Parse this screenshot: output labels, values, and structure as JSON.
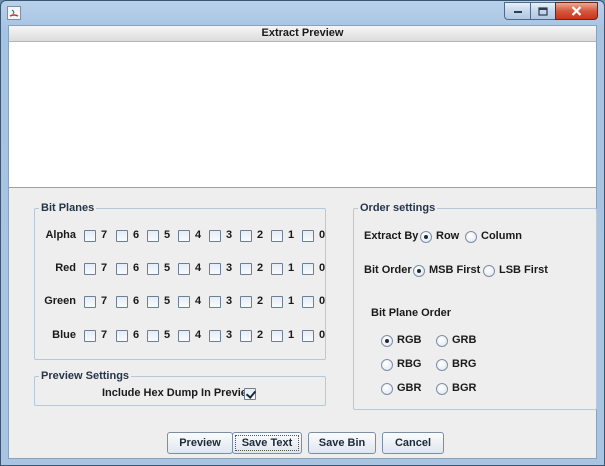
{
  "window": {
    "title": "",
    "icon": "java-app-icon",
    "controls": [
      "minimize-icon",
      "maximize-icon",
      "close-icon"
    ]
  },
  "preview": {
    "header": "Extract Preview",
    "content": ""
  },
  "bit_planes": {
    "legend": "Bit Planes",
    "bits": [
      "7",
      "6",
      "5",
      "4",
      "3",
      "2",
      "1",
      "0"
    ],
    "rows": [
      {
        "label": "Alpha",
        "checked": [
          false,
          false,
          false,
          false,
          false,
          false,
          false,
          false
        ]
      },
      {
        "label": "Red",
        "checked": [
          false,
          false,
          false,
          false,
          false,
          false,
          false,
          false
        ]
      },
      {
        "label": "Green",
        "checked": [
          false,
          false,
          false,
          false,
          false,
          false,
          false,
          false
        ]
      },
      {
        "label": "Blue",
        "checked": [
          false,
          false,
          false,
          false,
          false,
          false,
          false,
          false
        ]
      }
    ]
  },
  "preview_settings": {
    "legend": "Preview Settings",
    "hex_dump_label": "Include Hex Dump In Preview",
    "hex_dump_checked": true
  },
  "order_settings": {
    "legend": "Order settings",
    "extract_by": {
      "label": "Extract By",
      "options": [
        "Row",
        "Column"
      ],
      "selected": "Row"
    },
    "bit_order": {
      "label": "Bit Order",
      "options": [
        "MSB First",
        "LSB First"
      ],
      "selected": "MSB First"
    },
    "bit_plane_order": {
      "label": "Bit Plane Order",
      "options": [
        "RGB",
        "GRB",
        "RBG",
        "BRG",
        "GBR",
        "BGR"
      ],
      "selected": "RGB"
    }
  },
  "buttons": {
    "preview": "Preview",
    "save_text": "Save Text",
    "save_bin": "Save Bin",
    "cancel": "Cancel"
  }
}
